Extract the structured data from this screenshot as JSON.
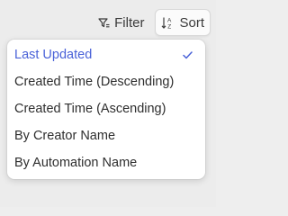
{
  "toolbar": {
    "filter_label": "Filter",
    "sort_label": "Sort"
  },
  "sort_menu": {
    "items": [
      {
        "label": "Last Updated",
        "selected": true
      },
      {
        "label": "Created Time (Descending)",
        "selected": false
      },
      {
        "label": "Created Time (Ascending)",
        "selected": false
      },
      {
        "label": "By Creator Name",
        "selected": false
      },
      {
        "label": "By Automation Name",
        "selected": false
      }
    ]
  },
  "icons": {
    "filter": "filter-icon",
    "sort": "sort-az-icon",
    "check": "checkmark-icon"
  },
  "colors": {
    "accent": "#4a62d8",
    "text": "#2e2e2e",
    "background": "#ececec",
    "menu_background": "#ffffff"
  }
}
